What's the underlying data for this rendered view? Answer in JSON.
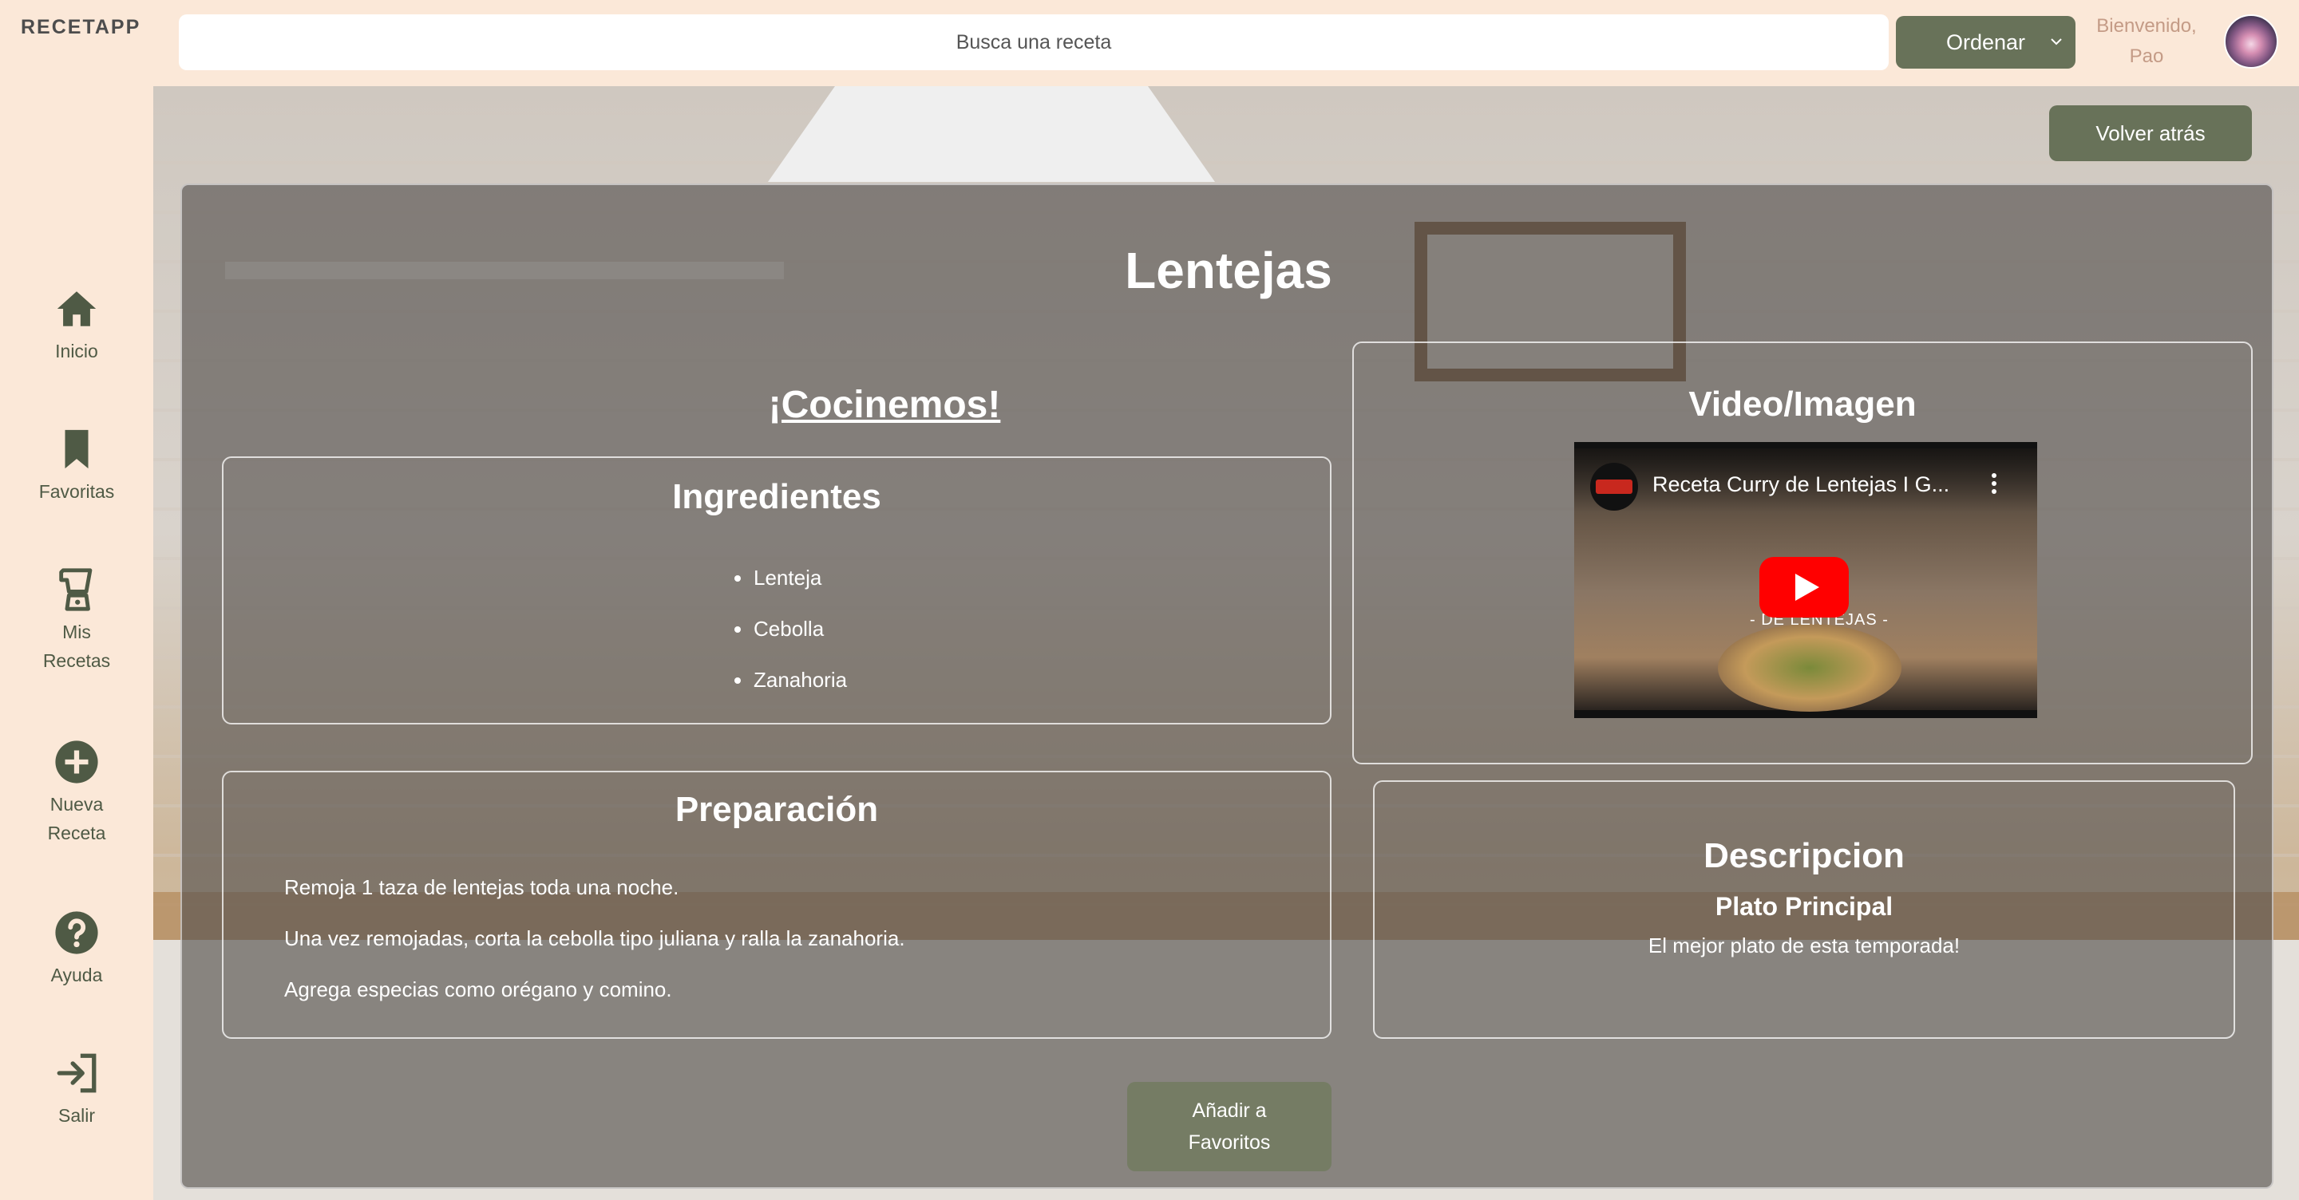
{
  "app": {
    "brand": "RECETAPP"
  },
  "colors": {
    "accent": "#687259",
    "sidebar_bg": "#fbe8d8",
    "card_overlay": "#58544F",
    "welcome_text": "#c49b86"
  },
  "sidebar": {
    "items": [
      {
        "label": "Inicio",
        "icon": "home-icon"
      },
      {
        "label": "Favoritas",
        "icon": "bookmark-icon"
      },
      {
        "label": "Mis Recetas",
        "icon": "blender-icon"
      },
      {
        "label": "Nueva Receta",
        "icon": "plus-circle-icon"
      },
      {
        "label": "Ayuda",
        "icon": "help-circle-icon"
      },
      {
        "label": "Salir",
        "icon": "logout-icon"
      }
    ]
  },
  "header": {
    "search_placeholder": "Busca una receta",
    "sort_label": "Ordenar",
    "welcome": "Bienvenido, Pao"
  },
  "main": {
    "back_label": "Volver atrás",
    "recipe": {
      "title": "Lentejas",
      "cook_link": "¡Cocinemos!",
      "ingredients_title": "Ingredientes",
      "ingredients": [
        "Lenteja",
        "Cebolla",
        "Zanahoria"
      ],
      "preparation_title": "Preparación",
      "steps": [
        "Remoja 1 taza de lentejas toda una noche.",
        "Una vez remojadas, corta la cebolla tipo juliana y ralla la zanahoria.",
        "Agrega especias como orégano y comino."
      ],
      "media_title": "Video/Imagen",
      "video_title": "Receta Curry de Lentejas I G...",
      "video_subtitle": "- DE LENTEJAS -",
      "description_title": "Descripcion",
      "category": "Plato Principal",
      "description": "El mejor plato de esta temporada!"
    },
    "favorite_label": "Añadir a Favoritos"
  }
}
